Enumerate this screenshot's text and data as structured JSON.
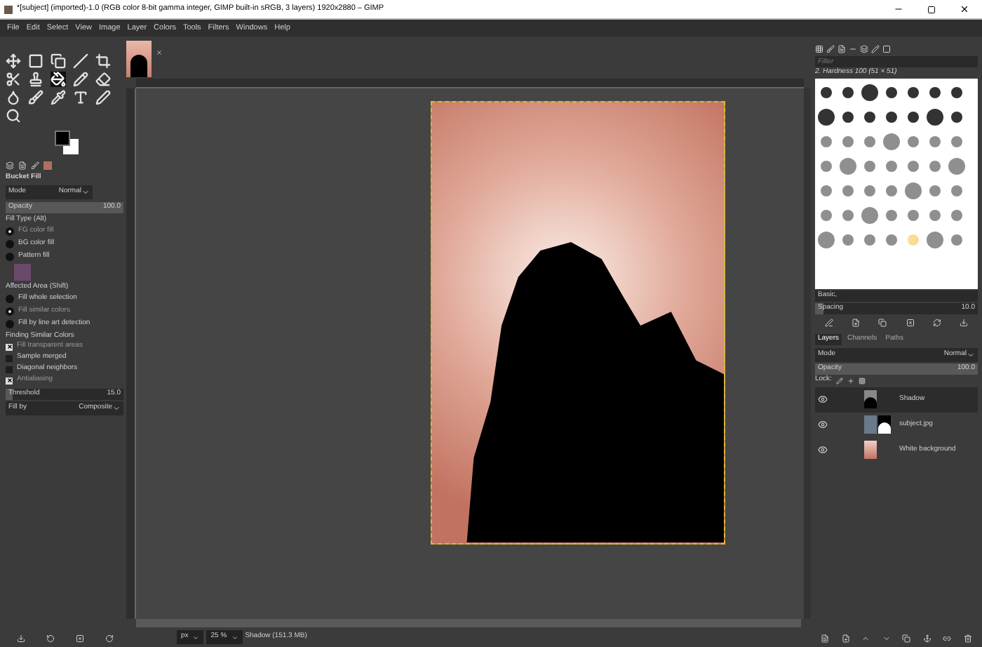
{
  "window": {
    "title": "*[subject] (imported)-1.0 (RGB color 8-bit gamma integer, GIMP built-in sRGB, 3 layers) 1920x2880 – GIMP"
  },
  "menu": [
    "File",
    "Edit",
    "Select",
    "View",
    "Image",
    "Layer",
    "Colors",
    "Tools",
    "Filters",
    "Windows",
    "Help"
  ],
  "tool_options": {
    "title": "Bucket Fill",
    "mode_label": "Mode",
    "mode": "Normal",
    "opacity": {
      "label": "Opacity",
      "value": "100.0",
      "level": 1
    },
    "fill_type_label": "Fill Type  (Alt)",
    "fill_types": [
      {
        "label": "FG color fill",
        "selected": true
      },
      {
        "label": "BG color fill",
        "selected": false
      },
      {
        "label": "Pattern fill",
        "selected": false
      }
    ],
    "affected_label": "Affected Area  (Shift)",
    "affected": [
      {
        "label": "Fill whole selection",
        "selected": false
      },
      {
        "label": "Fill similar colors",
        "selected": true
      },
      {
        "label": "Fill by line art detection",
        "selected": false
      }
    ],
    "similar_label": "Finding Similar Colors",
    "similar": [
      {
        "label": "Fill transparent areas",
        "checked": true
      },
      {
        "label": "Sample merged",
        "checked": false
      },
      {
        "label": "Diagonal neighbors",
        "checked": false
      },
      {
        "label": "Antialiasing",
        "checked": true
      }
    ],
    "threshold": {
      "label": "Threshold",
      "value": "15.0",
      "level": 0.06
    },
    "fill_by_label": "Fill by",
    "fill_by": "Composite"
  },
  "brushes": {
    "filter_placeholder": "Filter",
    "brush_name": "2. Hardness 100 (51 × 51)",
    "preset": "Basic,",
    "spacing": {
      "label": "Spacing",
      "value": "10.0",
      "level": 0.05
    }
  },
  "layers_panel": {
    "tabs": [
      {
        "label": "Layers",
        "selected": true
      },
      {
        "label": "Channels",
        "selected": false
      },
      {
        "label": "Paths",
        "selected": false
      }
    ],
    "mode_label": "Mode",
    "mode": "Normal",
    "opacity": {
      "label": "Opacity",
      "value": "100.0",
      "level": 1
    },
    "lock_label": "Lock:",
    "layers": [
      {
        "name": "Shadow",
        "visible": true,
        "selected": true,
        "kind": "shadow"
      },
      {
        "name": "subject.jpg",
        "visible": true,
        "selected": false,
        "kind": "masked"
      },
      {
        "name": "White background",
        "visible": true,
        "selected": false,
        "kind": "gradient"
      }
    ]
  },
  "status_bar": {
    "unit": "px",
    "zoom": "25 %",
    "message": "Shadow (151.3 MB)"
  }
}
